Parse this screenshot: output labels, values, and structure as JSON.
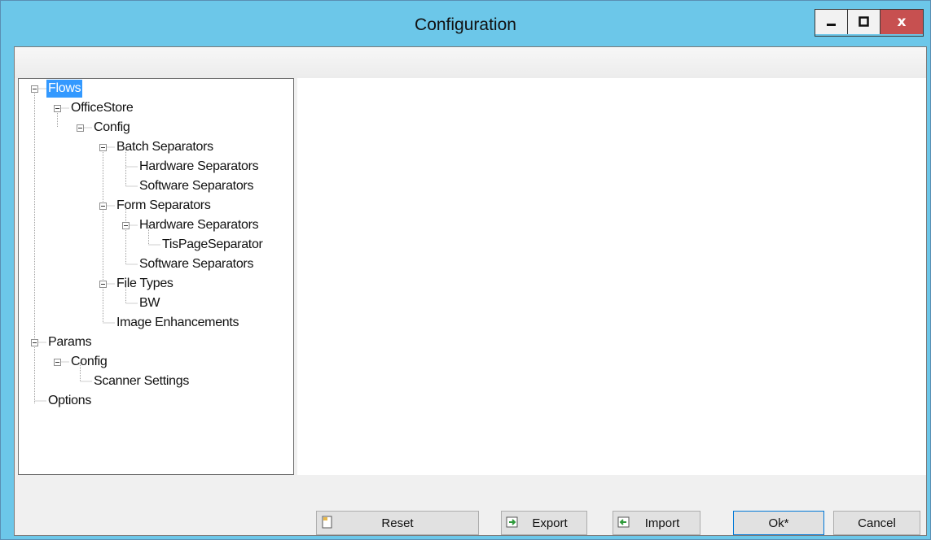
{
  "window": {
    "title": "Configuration",
    "controls": [
      "minimize-icon",
      "maximize-icon",
      "close-icon"
    ],
    "close_glyph": "x"
  },
  "tree": {
    "nodes": [
      {
        "label": "Flows",
        "selected": true
      },
      {
        "label": "OfficeStore"
      },
      {
        "label": "Config"
      },
      {
        "label": "Batch Separators"
      },
      {
        "label": "Hardware Separators"
      },
      {
        "label": "Software Separators"
      },
      {
        "label": "Form Separators"
      },
      {
        "label": "Hardware Separators"
      },
      {
        "label": "TisPageSeparator"
      },
      {
        "label": "Software Separators"
      },
      {
        "label": "File Types"
      },
      {
        "label": "BW"
      },
      {
        "label": "Image Enhancements"
      },
      {
        "label": "Params"
      },
      {
        "label": "Config"
      },
      {
        "label": "Scanner Settings"
      },
      {
        "label": "Options"
      }
    ]
  },
  "buttons": {
    "reset": "Reset",
    "export": "Export",
    "import": "Import",
    "ok": "Ok*",
    "cancel": "Cancel"
  },
  "colors": {
    "titlebar": "#6cc7e9",
    "close_button": "#c75050",
    "selection": "#3399ff"
  }
}
